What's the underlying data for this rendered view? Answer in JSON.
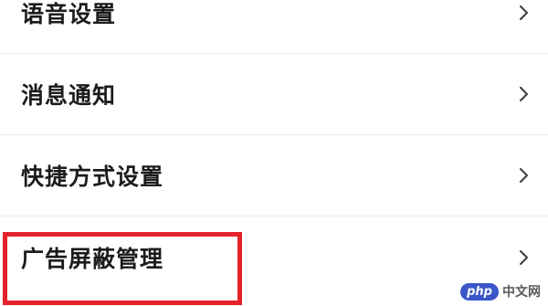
{
  "settings_list": {
    "items": [
      {
        "label": "语音设置"
      },
      {
        "label": "消息通知"
      },
      {
        "label": "快捷方式设置"
      },
      {
        "label": "广告屏蔽管理"
      }
    ]
  },
  "highlight": {
    "color": "#e5232a",
    "target": "广告屏蔽管理"
  },
  "watermark": {
    "badge": "php",
    "text": "中文网"
  }
}
